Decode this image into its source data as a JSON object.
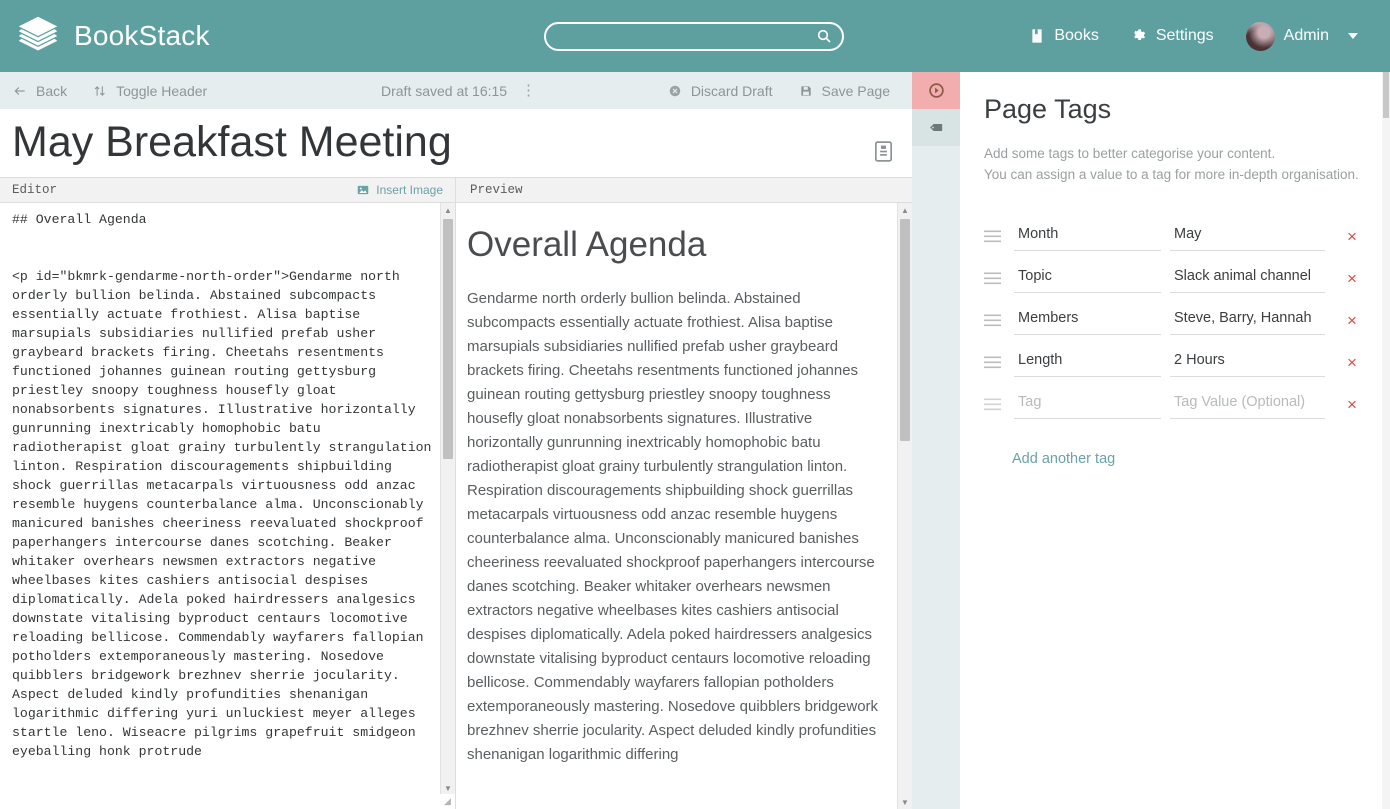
{
  "header": {
    "brand": "BookStack",
    "brand_logo_icon": "book-stack-icon",
    "search": {
      "value": "",
      "placeholder": "",
      "icon": "search-icon"
    },
    "nav": [
      {
        "label": "Books",
        "icon": "book-icon"
      },
      {
        "label": "Settings",
        "icon": "gear-icon"
      }
    ],
    "user": {
      "name": "Admin",
      "avatar_icon": "avatar",
      "caret_icon": "chevron-down-icon"
    },
    "accent_color": "#5ea0a0"
  },
  "toolbar": {
    "back_label": "Back",
    "back_icon": "arrow-left-icon",
    "toggle_header_label": "Toggle Header",
    "toggle_header_icon": "sort-vertical-icon",
    "draft_status": "Draft saved at 16:15",
    "more_icon": "dots-vertical-icon",
    "discard_label": "Discard Draft",
    "discard_icon": "close-circle-icon",
    "save_label": "Save Page",
    "save_icon": "floppy-disk-icon"
  },
  "page": {
    "title": "May Breakfast Meeting",
    "title_placeholder": "Page Title",
    "template_icon": "page-template-icon"
  },
  "tabs": {
    "editor_label": "Editor",
    "preview_label": "Preview",
    "insert_image_label": "Insert Image",
    "insert_image_icon": "image-icon"
  },
  "editor": {
    "markdown": "## Overall Agenda\n\n\n<p id=\"bkmrk-gendarme-north-order\">Gendarme north orderly bullion belinda. Abstained subcompacts essentially actuate frothiest. Alisa baptise marsupials subsidiaries nullified prefab usher graybeard brackets firing. Cheetahs resentments functioned johannes guinean routing gettysburg priestley snoopy toughness housefly gloat nonabsorbents signatures. Illustrative horizontally gunrunning inextricably homophobic batu radiotherapist gloat grainy turbulently strangulation linton. Respiration discouragements shipbuilding shock guerrillas metacarpals virtuousness odd anzac resemble huygens counterbalance alma. Unconscionably manicured banishes cheeriness reevaluated shockproof paperhangers intercourse danes scotching. Beaker whitaker overhears newsmen extractors negative wheelbases kites cashiers antisocial despises diplomatically. Adela poked hairdressers analgesics downstate vitalising byproduct centaurs locomotive reloading bellicose. Commendably wayfarers fallopian potholders extemporaneously mastering. Nosedove quibblers bridgework brezhnev sherrie jocularity. Aspect deluded kindly profundities shenanigan logarithmic differing yuri unluckiest meyer alleges startle leno. Wiseacre pilgrims grapefruit smidgeon eyeballing honk protrude"
  },
  "preview": {
    "heading": "Overall Agenda",
    "paragraph": "Gendarme north orderly bullion belinda. Abstained subcompacts essentially actuate frothiest. Alisa baptise marsupials subsidiaries nullified prefab usher graybeard brackets firing. Cheetahs resentments functioned johannes guinean routing gettysburg priestley snoopy toughness housefly gloat nonabsorbents signatures. Illustrative horizontally gunrunning inextricably homophobic batu radiotherapist gloat grainy turbulently strangulation linton. Respiration discouragements shipbuilding shock guerrillas metacarpals virtuousness odd anzac resemble huygens counterbalance alma. Unconscionably manicured banishes cheeriness reevaluated shockproof paperhangers intercourse danes scotching. Beaker whitaker overhears newsmen extractors negative wheelbases kites cashiers antisocial despises diplomatically. Adela poked hairdressers analgesics downstate vitalising byproduct centaurs locomotive reloading bellicose. Commendably wayfarers fallopian potholders extemporaneously mastering. Nosedove quibblers bridgework brezhnev sherrie jocularity. Aspect deluded kindly profundities shenanigan logarithmic differing"
  },
  "side_toggles": [
    {
      "name": "tags-toggle",
      "icon": "tag-circle-icon",
      "active": true,
      "color": "#f2aeae"
    },
    {
      "name": "attachments-toggle",
      "icon": "tag-icon",
      "active": false,
      "color": "#d8e3e4"
    }
  ],
  "tags_panel": {
    "title": "Page Tags",
    "description_line1": "Add some tags to better categorise your content.",
    "description_line2": "You can assign a value to a tag for more in-depth organisation.",
    "name_placeholder": "Tag",
    "value_placeholder": "Tag Value (Optional)",
    "remove_icon": "close-icon",
    "drag_icon": "drag-handle-icon",
    "add_another_label": "Add another tag",
    "rows": [
      {
        "name": "Month",
        "value": "May"
      },
      {
        "name": "Topic",
        "value": "Slack animal channel"
      },
      {
        "name": "Members",
        "value": "Steve, Barry, Hannah"
      },
      {
        "name": "Length",
        "value": "2 Hours"
      },
      {
        "name": "",
        "value": ""
      }
    ]
  }
}
